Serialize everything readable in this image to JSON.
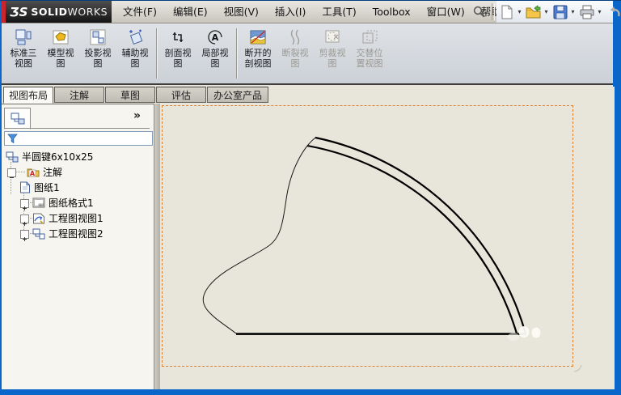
{
  "window": {
    "logo_mark": "ƷS",
    "logo_solid": "SOLID",
    "logo_works": "WORKS"
  },
  "colors": {
    "window_border": "#0b66c9",
    "canvas_background": "#e8e6da",
    "sheet_border": "#dd8333",
    "logo_stripe": "#c8252c",
    "commandbar_background": "#d4d8dd"
  },
  "menubar": {
    "items": [
      {
        "label": "文件(F)"
      },
      {
        "label": "编辑(E)"
      },
      {
        "label": "视图(V)"
      },
      {
        "label": "插入(I)"
      },
      {
        "label": "工具(T)"
      },
      {
        "label": "Toolbox"
      },
      {
        "label": "窗口(W)"
      },
      {
        "label": "帮助(H)"
      }
    ]
  },
  "quick_toolbar": {
    "buttons": [
      {
        "name": "new-document",
        "has_dropdown": true
      },
      {
        "name": "open",
        "has_dropdown": true
      },
      {
        "name": "save",
        "has_dropdown": true
      },
      {
        "name": "print",
        "has_dropdown": true
      },
      {
        "name": "undo",
        "has_dropdown": false,
        "enabled": false
      }
    ],
    "caret": "▾"
  },
  "command_manager": {
    "buttons": [
      {
        "label": "标准三视图",
        "line1": "标准三",
        "line2": "视图",
        "enabled": true
      },
      {
        "label": "模型视图",
        "line1": "模型视",
        "line2": "图",
        "enabled": true
      },
      {
        "label": "投影视图",
        "line1": "投影视",
        "line2": "图",
        "enabled": true
      },
      {
        "label": "辅助视图",
        "line1": "辅助视",
        "line2": "图",
        "enabled": true
      },
      {
        "label": "剖面视图",
        "line1": "剖面视",
        "line2": "图",
        "enabled": true
      },
      {
        "label": "局部视图",
        "line1": "局部视",
        "line2": "图",
        "enabled": true
      },
      {
        "label": "断开的剖视图",
        "line1": "断开的",
        "line2": "剖视图",
        "enabled": true
      },
      {
        "label": "断裂视图",
        "line1": "断裂视",
        "line2": "图",
        "enabled": false
      },
      {
        "label": "剪裁视图",
        "line1": "剪裁视",
        "line2": "图",
        "enabled": false
      },
      {
        "label": "交替位置视图",
        "line1": "交替位",
        "line2": "置视图",
        "enabled": false
      }
    ]
  },
  "tabs": {
    "items": [
      {
        "label": "视图布局",
        "active": true
      },
      {
        "label": "注解",
        "active": false
      },
      {
        "label": "草图",
        "active": false
      },
      {
        "label": "评估",
        "active": false
      },
      {
        "label": "办公室产品",
        "active": false
      }
    ]
  },
  "feature_tree": {
    "panel_chevron": "»",
    "root": {
      "label": "半圆键6x10x25"
    },
    "items": [
      {
        "label": "注解",
        "level": 1,
        "expander": "none"
      },
      {
        "label": "图纸1",
        "level": 0,
        "expander": "minus"
      },
      {
        "label": "图纸格式1",
        "level": 1,
        "expander": "plus"
      },
      {
        "label": "工程图视图1",
        "level": 1,
        "expander": "plus"
      },
      {
        "label": "工程图视图2",
        "level": 1,
        "expander": "plus"
      }
    ]
  }
}
